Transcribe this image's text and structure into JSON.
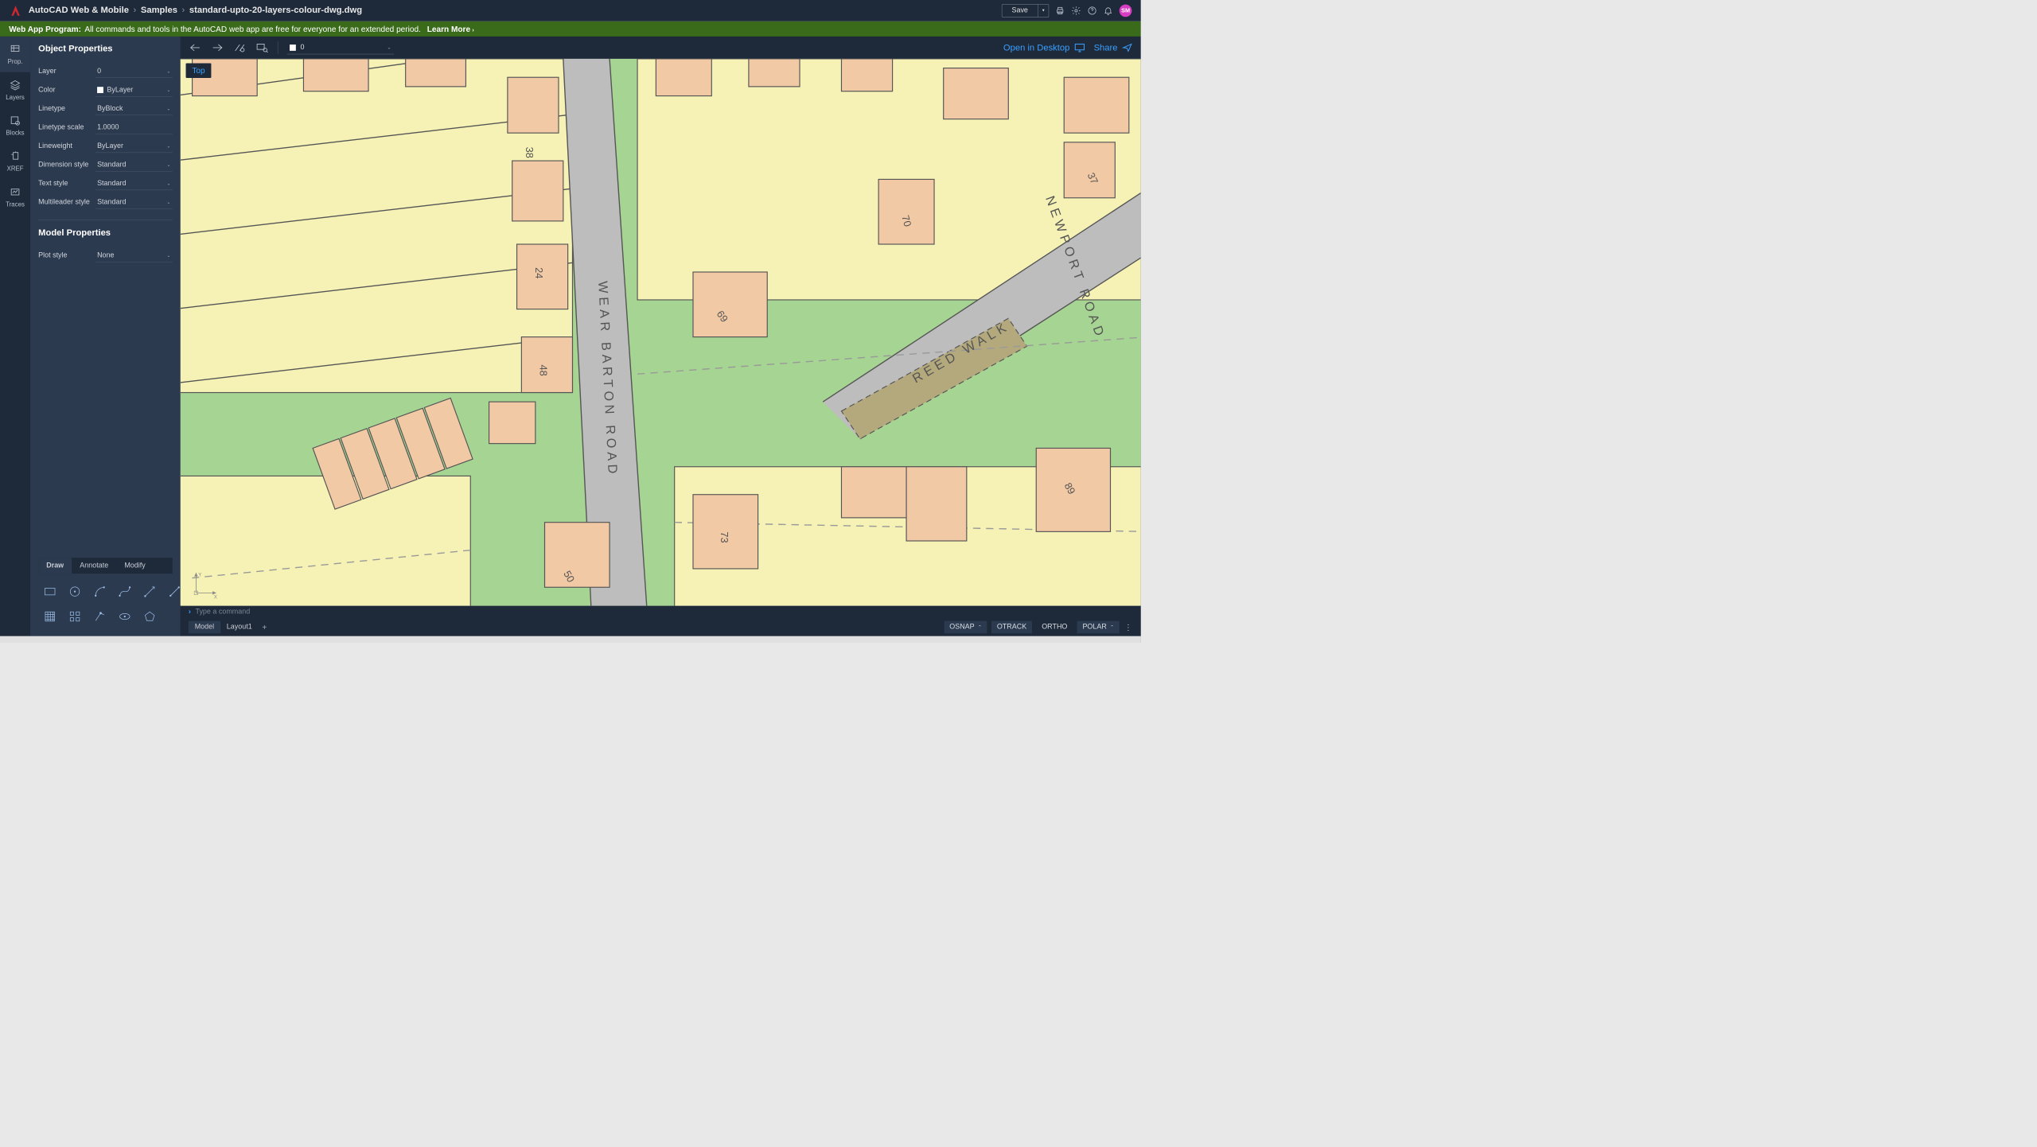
{
  "titlebar": {
    "product": "AutoCAD Web & Mobile",
    "crumb1": "Samples",
    "crumb2": "standard-upto-20-layers-colour-dwg.dwg",
    "save": "Save",
    "avatar": "SM"
  },
  "banner": {
    "lead": "Web App Program:",
    "body": "All commands and tools in the AutoCAD web app are free for everyone for an extended period.",
    "learn": "Learn More"
  },
  "rail": {
    "prop": "Prop.",
    "layers": "Layers",
    "blocks": "Blocks",
    "xref": "XREF",
    "traces": "Traces"
  },
  "props": {
    "h1": "Object Properties",
    "layer_l": "Layer",
    "layer_v": "0",
    "color_l": "Color",
    "color_v": "ByLayer",
    "ltype_l": "Linetype",
    "ltype_v": "ByBlock",
    "ltscale_l": "Linetype scale",
    "ltscale_v": "1.0000",
    "lweight_l": "Lineweight",
    "lweight_v": "ByLayer",
    "dimstyle_l": "Dimension style",
    "dimstyle_v": "Standard",
    "txtstyle_l": "Text style",
    "txtstyle_v": "Standard",
    "mlstyle_l": "Multileader style",
    "mlstyle_v": "Standard",
    "h2": "Model Properties",
    "plot_l": "Plot style",
    "plot_v": "None"
  },
  "tooltabs": {
    "draw": "Draw",
    "annotate": "Annotate",
    "modify": "Modify"
  },
  "docbar": {
    "layer_v": "0",
    "open_desktop": "Open in Desktop",
    "share": "Share"
  },
  "canvas": {
    "viewlabel": "Top",
    "road1": "WEAR BARTON ROAD",
    "road2": "NEWPORT ROAD",
    "road3": "REED WALK",
    "house_nums": [
      "38",
      "24",
      "48",
      "69",
      "73",
      "50",
      "70",
      "37",
      "89"
    ]
  },
  "cmdbar": {
    "placeholder": "Type a command"
  },
  "footer": {
    "model": "Model",
    "layout1": "Layout1",
    "osnap": "OSNAP",
    "otrack": "OTRACK",
    "ortho": "ORTHO",
    "polar": "POLAR"
  },
  "ucs": {
    "y": "Y",
    "x": "X"
  }
}
